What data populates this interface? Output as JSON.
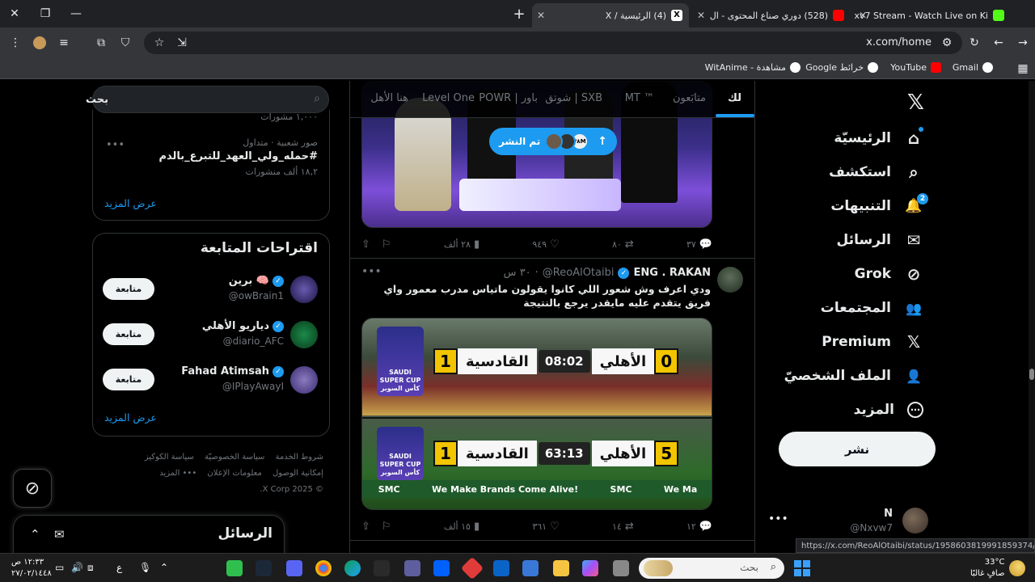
{
  "browser": {
    "tabs": [
      {
        "title": "Nxv7 Stream - Watch Live on Ki",
        "favicon_color": "#53fc18"
      },
      {
        "title": "(528) دوري صناع المحتوى - ال",
        "favicon_color": "#ff0000"
      },
      {
        "title": "(4) الرئيسية / X",
        "favicon_color": "#ffffff",
        "active": true
      }
    ],
    "url": "x.com/home",
    "bookmarks": [
      {
        "label": "Gmail",
        "color": "#ffffff"
      },
      {
        "label": "YouTube",
        "color": "#ff0000"
      },
      {
        "label": "خرائط Google",
        "color": "#ffffff"
      },
      {
        "label": "مشاهدة - WitAnime",
        "color": "#ffffff"
      }
    ]
  },
  "nav": {
    "items": [
      {
        "label": "الرئيسيّة",
        "icon": "home-icon",
        "glyph": "⌂"
      },
      {
        "label": "استكشف",
        "icon": "search-icon",
        "glyph": "⌕"
      },
      {
        "label": "التنبيهات",
        "icon": "bell-icon",
        "glyph": "🔔",
        "badge": "2"
      },
      {
        "label": "الرسائل",
        "icon": "mail-icon",
        "glyph": "✉"
      },
      {
        "label": "Grok",
        "icon": "grok-icon",
        "glyph": "⊘"
      },
      {
        "label": "المجتمعات",
        "icon": "communities-icon",
        "glyph": "👥"
      },
      {
        "label": "Premium",
        "icon": "x-premium-icon",
        "glyph": "𝕏"
      },
      {
        "label": "الملف الشخصيّ",
        "icon": "profile-icon",
        "glyph": "👤"
      },
      {
        "label": "المزيد",
        "icon": "more-circle-icon",
        "glyph": "⋯"
      }
    ],
    "post_label": "نشر",
    "account": {
      "name": "N",
      "handle": "@Nxvw7"
    }
  },
  "feed": {
    "tabs": [
      "لك",
      "متابَعون",
      "MT ™",
      "شوتق | SXB",
      "POWR | باور",
      "Level One",
      "هنا الأهل"
    ],
    "new_posts_pill": "تم النشر",
    "pill_badge": "٧٨M",
    "post1_actions": {
      "replies": "٣٧",
      "reposts": "٨٠",
      "likes": "٩٤٩",
      "views": "٢٨ ألف"
    },
    "tweet": {
      "name": "ENG . RAKAN",
      "handle": "@ReoAlOtaibi",
      "time": "٣٠ س",
      "text": "ودي اعرف وش شعور اللي كانوا يقولون ماتياس مدرب معمور واي فريق يتقدم عليه مايقدر يرجع بالنتيجة",
      "actions": {
        "replies": "١٢",
        "reposts": "١٤",
        "likes": "٣٦١",
        "views": "١٥ ألف"
      },
      "scoreboard1": {
        "home": "الأهلي",
        "home_score": "0",
        "away": "القادسية",
        "away_score": "1",
        "clock": "08:02"
      },
      "scoreboard2": {
        "home": "الأهلي",
        "home_score": "5",
        "away": "القادسية",
        "away_score": "1",
        "clock": "63:13"
      },
      "cup_label": "SAUDI SUPER CUP كأس السوبر",
      "banner": [
        "SMC",
        "We Make Brands Come Alive!",
        "SMC",
        "We Ma"
      ]
    }
  },
  "sidebar": {
    "search_placeholder": "بحث",
    "trend": {
      "top_meta": "١,٠٠٠ مشورات",
      "meta": "صور شعبية · متداول",
      "title": "#حمله_ولي_العهد_للتبرع_بالدم",
      "posts": "١٨,٢ ألف منشورات",
      "show_more": "عرض المزيد"
    },
    "follow": {
      "title": "اقتراحات المتابعة",
      "users": [
        {
          "name": "برين 🧠",
          "handle": "@owBrain1",
          "avatar_color": "#3a2a6a"
        },
        {
          "name": "دياريو الأهلي",
          "handle": "@diario_AFC",
          "avatar_color": "#0f6b3a"
        },
        {
          "name": "Fahad Atimsah",
          "handle": "@IPlayAwayI",
          "avatar_color": "#5a4aa0"
        }
      ],
      "follow_label": "متابعة",
      "show_more": "عرض المزيد"
    },
    "footer": {
      "links": [
        "شروط الخدمة",
        "سياسة الخصوصيّة",
        "سياسة الكوكيز",
        "إمكانية الوصول",
        "معلومات الإعلان",
        "••• المزيد"
      ],
      "copyright": "© 2025 X Corp."
    },
    "messages_title": "الرسائل"
  },
  "status_url": "https://x.com/ReoAlOtaibi/status/1958603819991859374/photo/1",
  "taskbar": {
    "search_label": "بحث",
    "weather_temp": "33°C",
    "weather_desc": "صافٍ غالبًا",
    "time": "١٢:٣٣ ص",
    "date": "٢٧/٠٢/١٤٤٨",
    "lang": "ع"
  }
}
